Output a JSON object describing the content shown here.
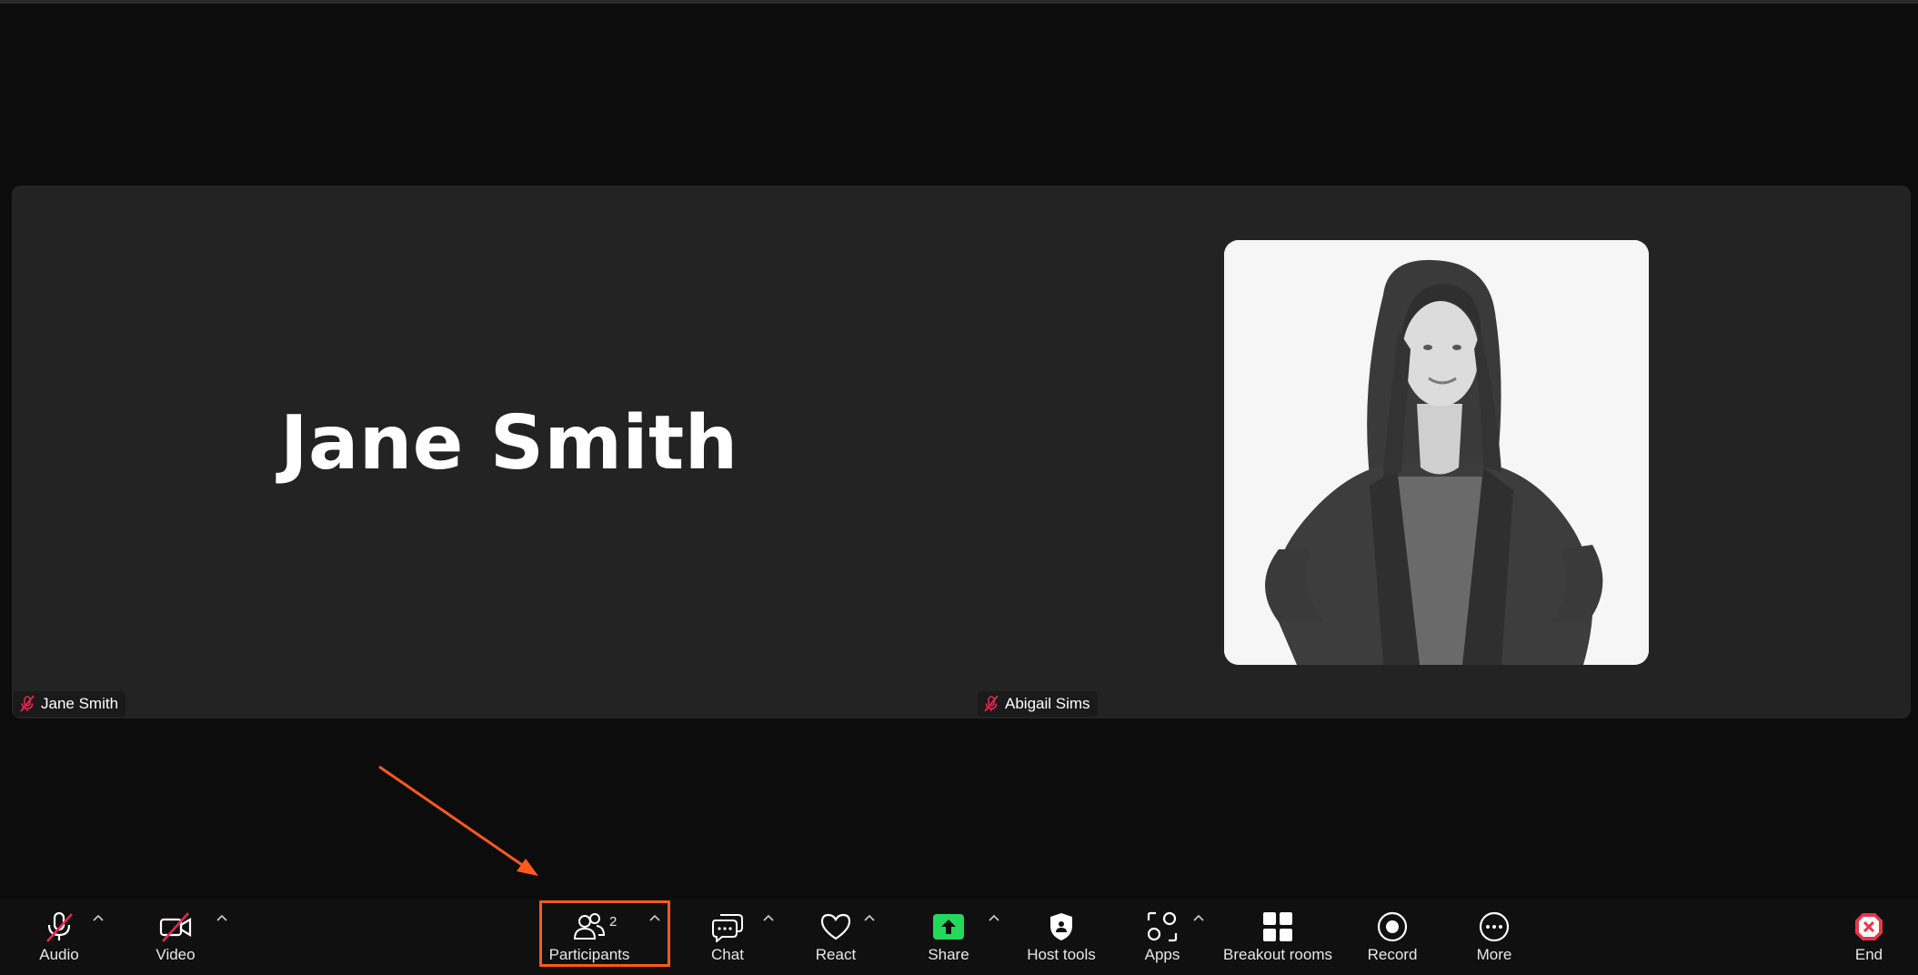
{
  "meeting": {
    "speaker_display_name": "Jane Smith",
    "participants": [
      {
        "name": "Jane Smith",
        "muted": true
      },
      {
        "name": "Abigail Sims",
        "muted": true
      }
    ]
  },
  "toolbar": {
    "audio_label": "Audio",
    "video_label": "Video",
    "participants_label": "Participants",
    "participants_count": "2",
    "chat_label": "Chat",
    "react_label": "React",
    "share_label": "Share",
    "host_tools_label": "Host tools",
    "apps_label": "Apps",
    "breakout_label": "Breakout rooms",
    "record_label": "Record",
    "more_label": "More",
    "end_label": "End"
  },
  "colors": {
    "background": "#0c0c0c",
    "stage": "#232323",
    "toolbar": "#101010",
    "muted_red": "#e5264f",
    "share_green": "#23d959",
    "highlight_orange": "#ff5a1f",
    "end_red": "#e8354b"
  },
  "icons": {
    "audio": "microphone-muted-icon",
    "video": "video-camera-off-icon",
    "participants": "participants-icon",
    "chat": "chat-bubbles-icon",
    "react": "heart-icon",
    "share": "share-screen-icon",
    "host_tools": "shield-icon",
    "apps": "apps-grid-icon",
    "breakout": "breakout-rooms-icon",
    "record": "record-icon",
    "more": "more-dots-icon",
    "end": "end-meeting-icon"
  }
}
